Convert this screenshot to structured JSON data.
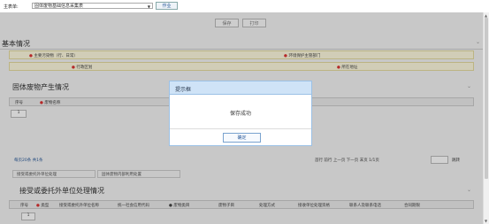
{
  "topbar": {
    "label": "主表单:",
    "select_value": "固体废物基础信息采集表",
    "button": "作业"
  },
  "header_buttons": [
    "保存",
    "打印"
  ],
  "sections": {
    "basic": "基本情况",
    "generation": "固体废物产生情况",
    "receiver": "接受或委托外单位处理情况"
  },
  "basic_fields": {
    "row1_left": "主要污染物（行、日常）",
    "row1_right": "环境保护主管部门",
    "row2_left": "行政区划",
    "row2_right": "所在地址"
  },
  "generation_table": {
    "headers": [
      "序号",
      "废物名称"
    ],
    "row_no": "1"
  },
  "pager": {
    "left": "每页20条 共1条",
    "right": "首行  前行  上一页  下一页  末页  1/1页",
    "go": "跳转"
  },
  "tabs": [
    "接受或委托外单位处理",
    "固体废物内部利用处置"
  ],
  "receiver_table": {
    "headers": [
      "序号",
      "类型",
      "接受或委托外单位名称",
      "统一社会信用代码",
      "● 废物类目",
      "废物子目",
      "处理方式",
      "接收单位处理资格",
      "联系人及联系电话",
      "合同期限"
    ],
    "row_no": "1"
  },
  "modal": {
    "title": "提示框",
    "message": "保存成功",
    "ok": "确定"
  }
}
